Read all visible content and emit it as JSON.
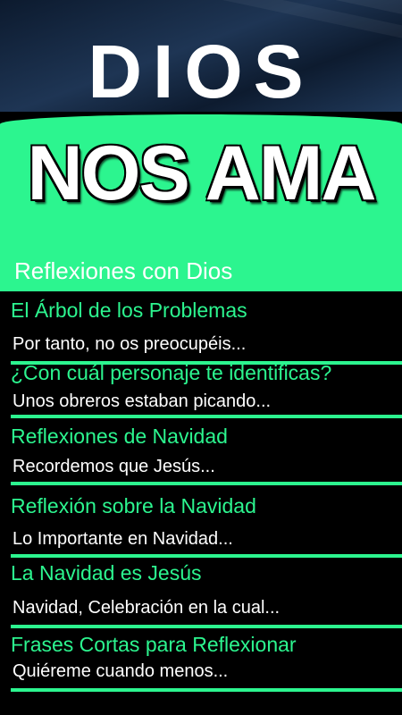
{
  "header": {
    "title_top": "DIOS",
    "title_bottom": "NOS AMA",
    "subtitle": "Reflexiones con Dios"
  },
  "items": [
    {
      "title": "El Árbol de los Problemas",
      "excerpt": "Por tanto, no os preocupéis..."
    },
    {
      "title": "¿Con cuál personaje te identificas?",
      "excerpt": "Unos obreros estaban picando..."
    },
    {
      "title": "Reflexiones de Navidad",
      "excerpt": "Recordemos que Jesús..."
    },
    {
      "title": "Reflexión sobre la Navidad",
      "excerpt": "Lo Importante en Navidad..."
    },
    {
      "title": "La Navidad es Jesús",
      "excerpt": "Navidad, Celebración en la cual..."
    },
    {
      "title": "Frases Cortas para Reflexionar",
      "excerpt": "Quiéreme cuando menos..."
    }
  ],
  "colors": {
    "accent": "#2cf58f",
    "background": "#000000",
    "hero": "#1e3554"
  }
}
